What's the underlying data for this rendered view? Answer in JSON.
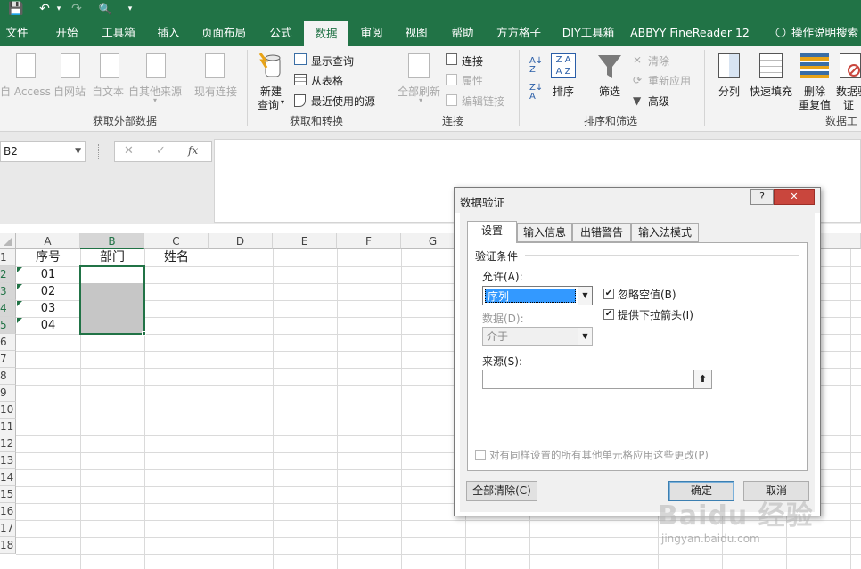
{
  "quick_access": {
    "save": "💾",
    "undo": "↶",
    "redo": "↷",
    "preview": "🔍",
    "more": "▾"
  },
  "tabs": [
    "文件",
    "开始",
    "工具箱",
    "插入",
    "页面布局",
    "公式",
    "数据",
    "审阅",
    "视图",
    "帮助",
    "方方格子",
    "DIY工具箱",
    "ABBYY FineReader 12"
  ],
  "active_tab": "数据",
  "tell_me": "操作说明搜索",
  "ribbon": {
    "get_external": {
      "label": "获取外部数据",
      "items": [
        "自 Access",
        "自网站",
        "自文本",
        "自其他来源",
        "现有连接"
      ]
    },
    "get_transform": {
      "label": "获取和转换",
      "new_query": "新建",
      "new_query2": "查询",
      "show_query": "显示查询",
      "from_table": "从表格",
      "recent_sources": "最近使用的源"
    },
    "connections": {
      "label": "连接",
      "refresh_all": "全部刷新",
      "connections": "连接",
      "properties": "属性",
      "edit_links": "编辑链接"
    },
    "sort_filter": {
      "label": "排序和筛选",
      "sort": "排序",
      "filter": "筛选",
      "clear": "清除",
      "reapply": "重新应用",
      "advanced": "高级"
    },
    "data_tools": {
      "label": "数据工",
      "split": "分列",
      "flash_fill": "快速填充",
      "remove_dup": "删除",
      "remove_dup2": "重复值",
      "validation": "数据验",
      "validation2": "证"
    }
  },
  "formula_bar": {
    "name_box": "B2",
    "cancel": "✕",
    "enter": "✓",
    "fx": "fx"
  },
  "columns": [
    "A",
    "B",
    "C",
    "D",
    "E",
    "F",
    "G"
  ],
  "rows": [
    "1",
    "2",
    "3",
    "4",
    "5",
    "6",
    "7",
    "8",
    "9",
    "10",
    "11",
    "12",
    "13",
    "14",
    "15",
    "16",
    "17",
    "18"
  ],
  "cells": {
    "A1": "序号",
    "B1": "部门",
    "C1": "姓名",
    "A2": "01",
    "A3": "02",
    "A4": "03",
    "A5": "04"
  },
  "dialog": {
    "title": "数据验证",
    "help": "?",
    "close": "✕",
    "tabs": [
      "设置",
      "输入信息",
      "出错警告",
      "输入法模式"
    ],
    "section": "验证条件",
    "allow_label": "允许(A):",
    "allow_value": "序列",
    "ignore_blank": "忽略空值(B)",
    "dropdown": "提供下拉箭头(I)",
    "data_label": "数据(D):",
    "data_value": "介于",
    "source_label": "来源(S):",
    "source_value": "",
    "apply_all": "对有同样设置的所有其他单元格应用这些更改(P)",
    "clear_all": "全部清除(C)",
    "ok": "确定",
    "cancel": "取消"
  },
  "watermark": {
    "brand": "Baidu 经验",
    "url": "jingyan.baidu.com"
  }
}
